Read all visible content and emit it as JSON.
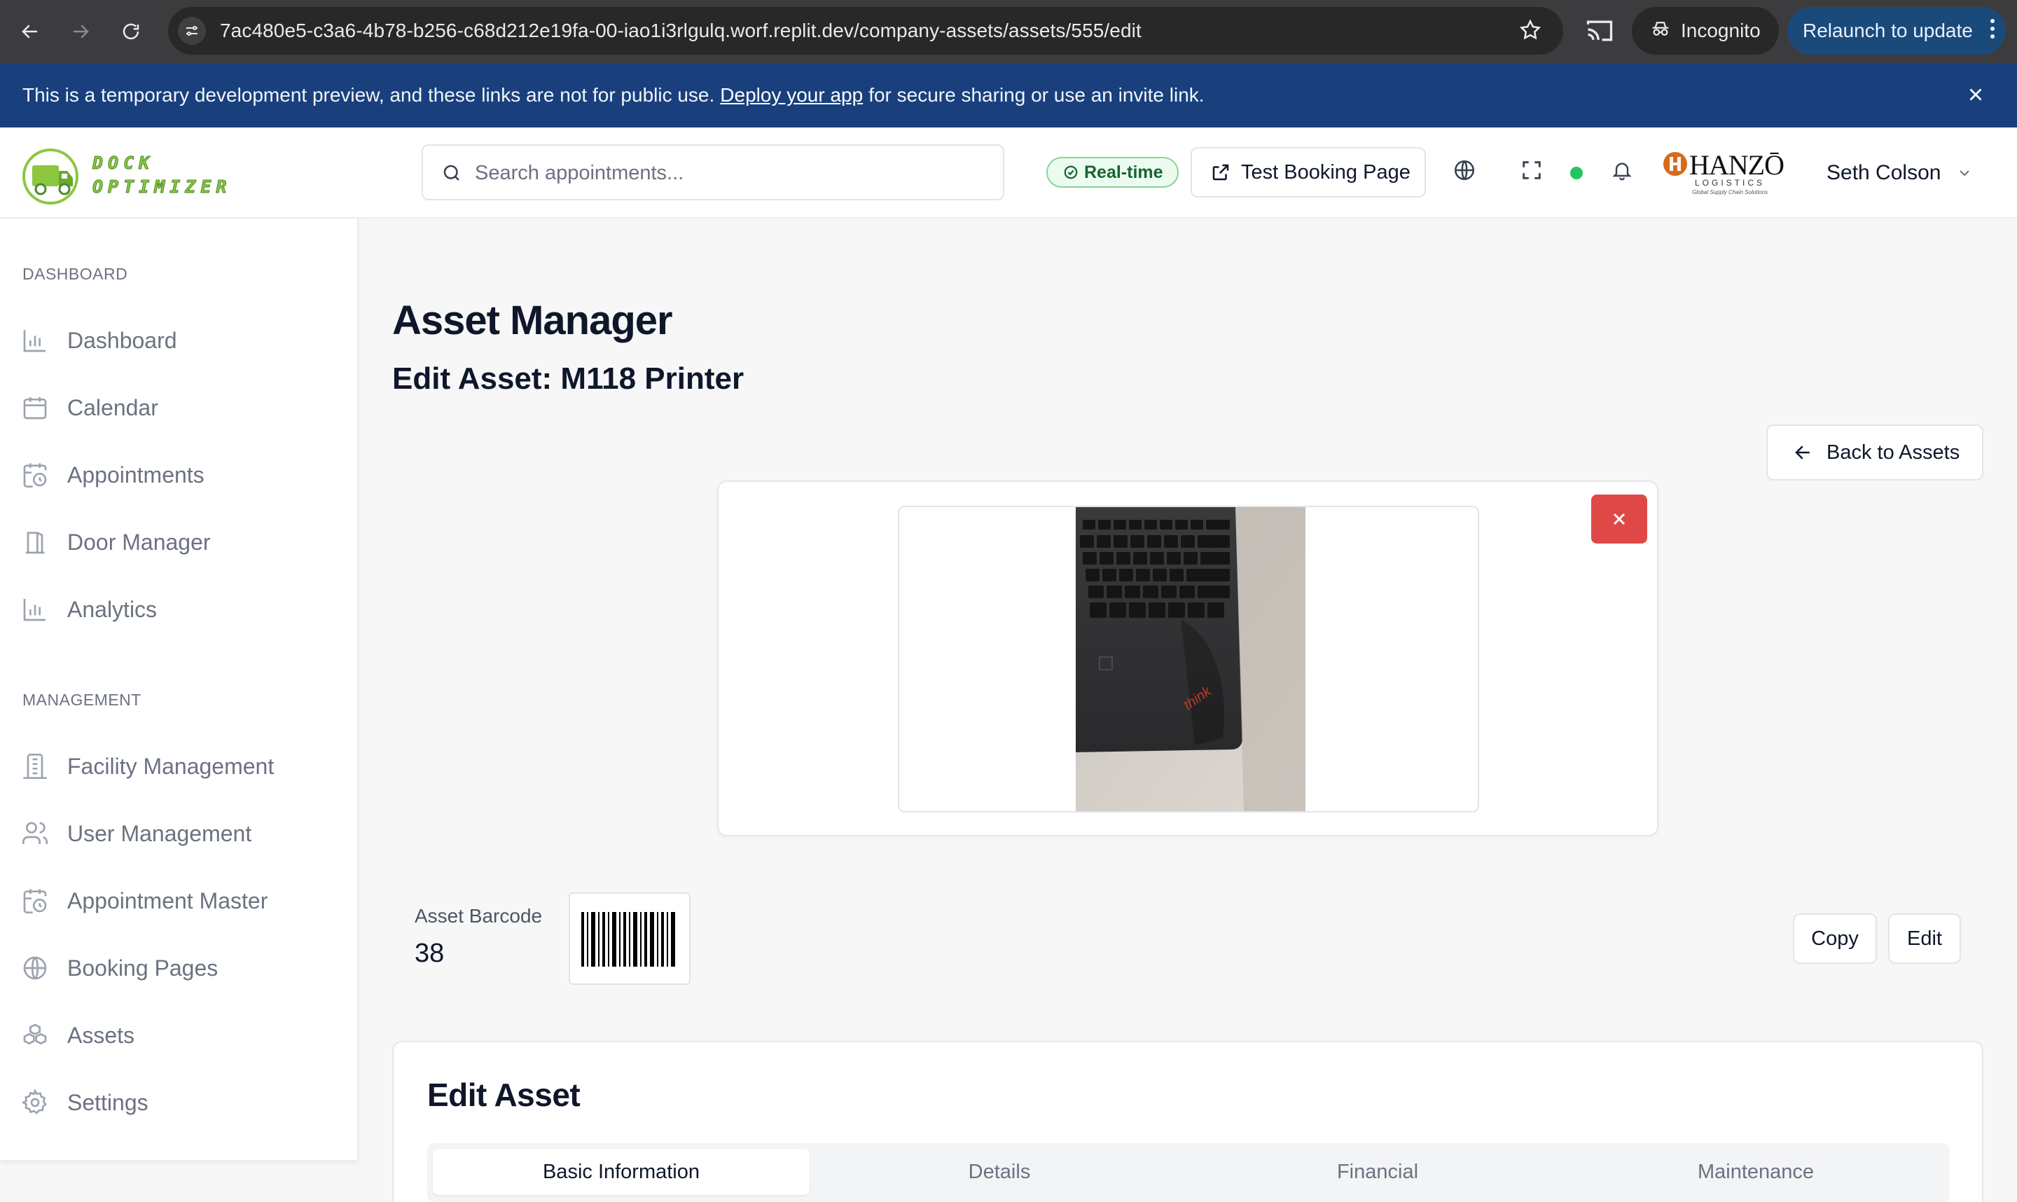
{
  "browser": {
    "url": "7ac480e5-c3a6-4b78-b256-c68d212e19fa-00-iao1i3rlgulq.worf.replit.dev/company-assets/assets/555/edit",
    "incognito_label": "Incognito",
    "relaunch_label": "Relaunch to update"
  },
  "banner": {
    "text_before": "This is a temporary development preview, and these links are not for public use.",
    "link_text": "Deploy your app",
    "text_after": "for secure sharing or use an invite link."
  },
  "header": {
    "logo_line1": "DOCK",
    "logo_line2": "OPTIMIZER",
    "search_placeholder": "Search appointments...",
    "realtime_label": "Real-time",
    "test_booking_label": "Test Booking Page",
    "company_name": "HANZŌ",
    "company_sub": "LOGISTICS",
    "company_tagline": "Global Supply Chain Solutions",
    "user_name": "Seth Colson"
  },
  "sidebar": {
    "section1": "DASHBOARD",
    "items1": [
      {
        "label": "Dashboard",
        "icon": "bar-chart-icon"
      },
      {
        "label": "Calendar",
        "icon": "calendar-icon"
      },
      {
        "label": "Appointments",
        "icon": "calendar-clock-icon"
      },
      {
        "label": "Door Manager",
        "icon": "door-icon"
      },
      {
        "label": "Analytics",
        "icon": "bar-chart-icon"
      }
    ],
    "section2": "MANAGEMENT",
    "items2": [
      {
        "label": "Facility Management",
        "icon": "building-icon"
      },
      {
        "label": "User Management",
        "icon": "users-icon"
      },
      {
        "label": "Appointment Master",
        "icon": "calendar-clock-icon"
      },
      {
        "label": "Booking Pages",
        "icon": "globe-icon"
      },
      {
        "label": "Assets",
        "icon": "boxes-icon"
      },
      {
        "label": "Settings",
        "icon": "gear-icon"
      }
    ]
  },
  "main": {
    "title": "Asset Manager",
    "subtitle": "Edit Asset: M118 Printer",
    "back_label": "Back to Assets",
    "barcode_label": "Asset Barcode",
    "barcode_value": "38",
    "copy_label": "Copy",
    "edit_label": "Edit",
    "edit_card_title": "Edit Asset",
    "tabs": [
      "Basic Information",
      "Details",
      "Financial",
      "Maintenance"
    ],
    "active_tab": "Basic Information"
  },
  "colors": {
    "banner": "#19407d",
    "delete": "#e04848",
    "status_online": "#22c55e",
    "logo_green": "#8dc63f"
  }
}
